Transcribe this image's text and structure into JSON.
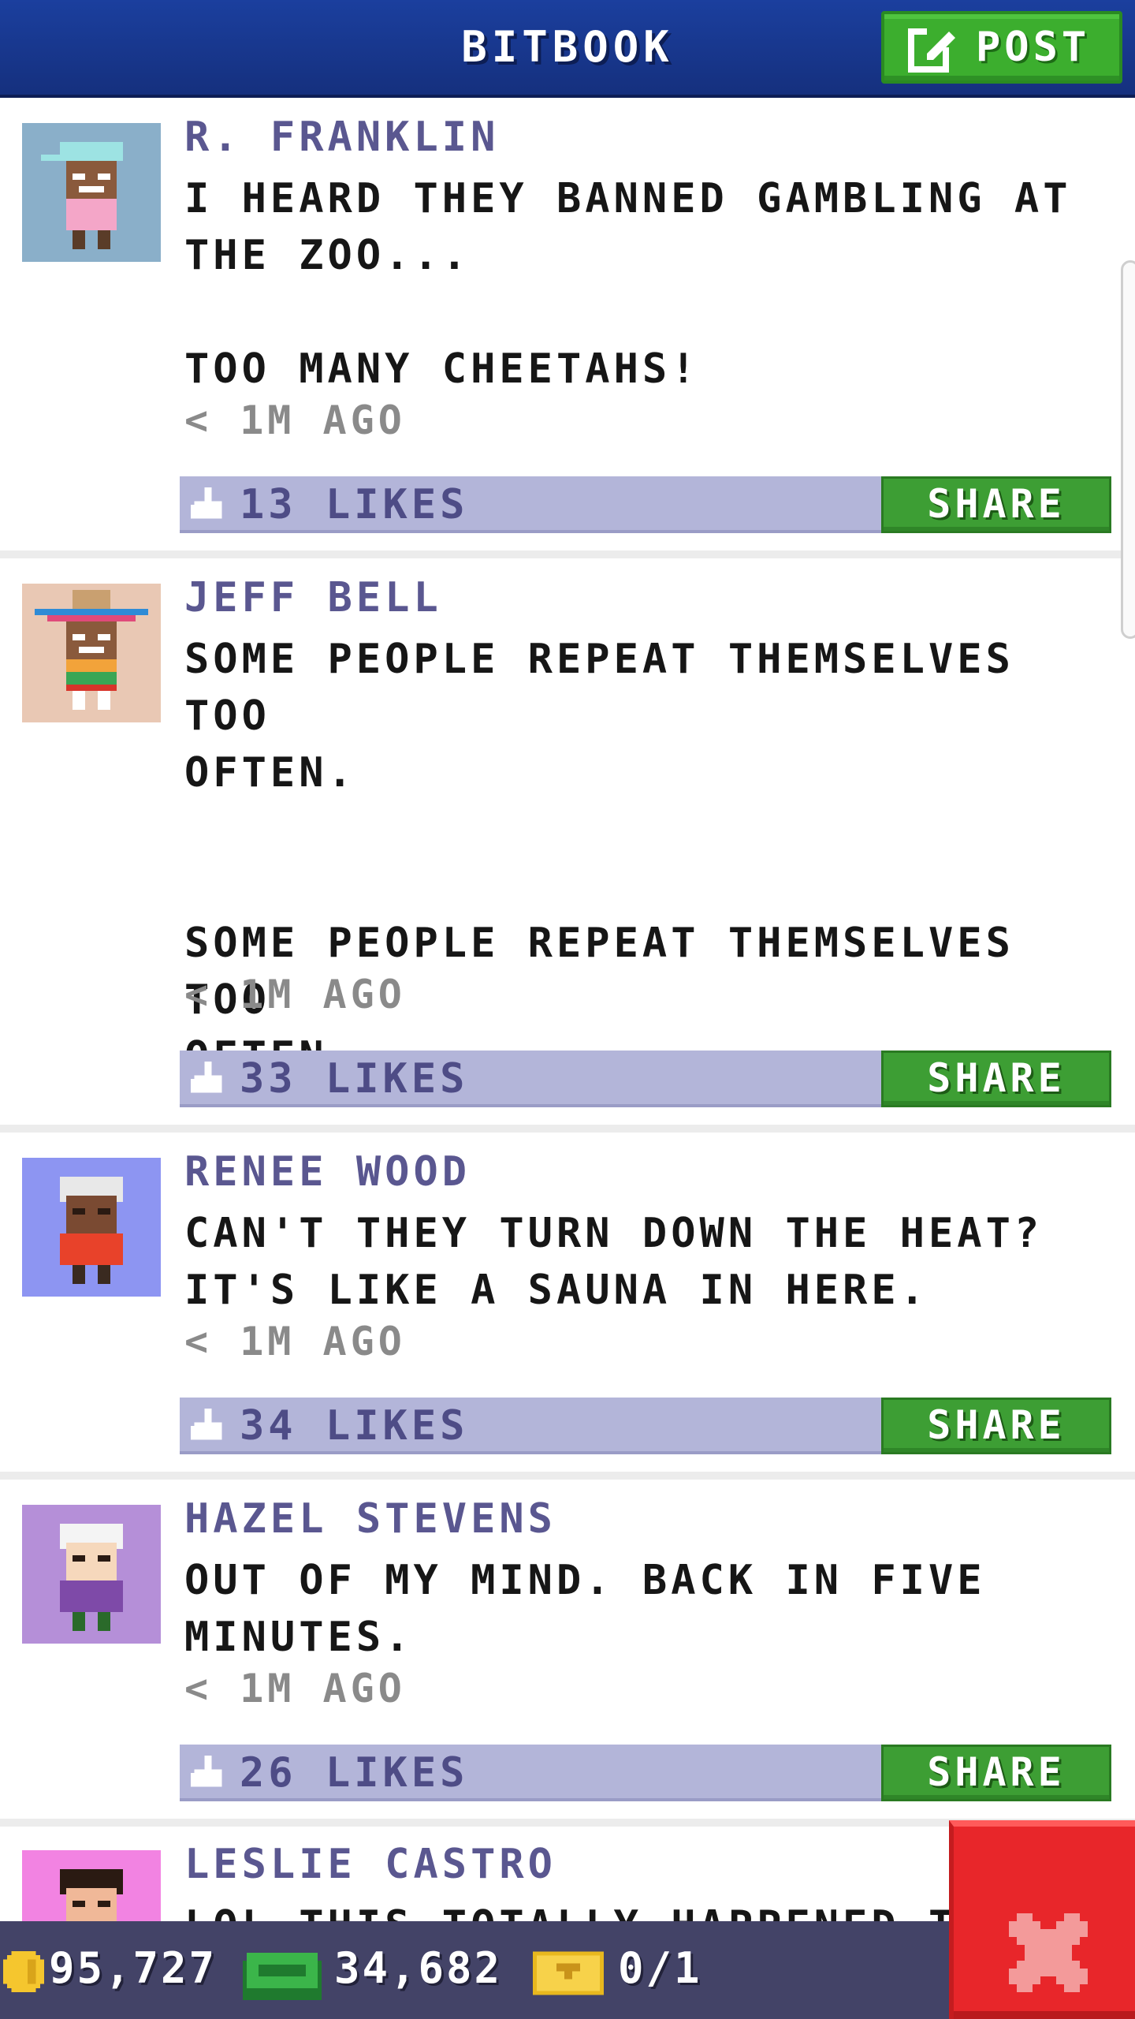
{
  "header": {
    "title": "BITBOOK",
    "post_label": "POST"
  },
  "posts": [
    {
      "author": "R. FRANKLIN",
      "text": "I HEARD THEY BANNED GAMBLING AT\nTHE ZOO...\n\nTOO MANY CHEETAHS!",
      "time": "< 1M AGO",
      "likes": "13 LIKES",
      "share_label": "SHARE",
      "avatar_bg": "#8aafc9"
    },
    {
      "author": "JEFF BELL",
      "text": "SOME PEOPLE REPEAT THEMSELVES TOO\nOFTEN.\n\n\nSOME PEOPLE REPEAT THEMSELVES TOO\nOFTEN.",
      "time": "< 1M AGO",
      "likes": "33 LIKES",
      "share_label": "SHARE",
      "avatar_bg": "#e9c8b4"
    },
    {
      "author": "RENEE WOOD",
      "text": "CAN'T THEY TURN DOWN THE HEAT?\nIT'S LIKE A SAUNA IN HERE.",
      "time": "< 1M AGO",
      "likes": "34 LIKES",
      "share_label": "SHARE",
      "avatar_bg": "#8d95f2"
    },
    {
      "author": "HAZEL STEVENS",
      "text": "OUT OF MY MIND. BACK IN FIVE\nMINUTES.",
      "time": "< 1M AGO",
      "likes": "26 LIKES",
      "share_label": "SHARE",
      "avatar_bg": "#b58fd8"
    },
    {
      "author": "LESLIE CASTRO",
      "text": "LOL THIS TOTALLY HAPPENED TO",
      "avatar_bg": "#f283e2"
    }
  ],
  "status": {
    "coins": "95,727",
    "bux": "34,682",
    "tickets": "0/1"
  },
  "colors": {
    "header": "#1b3f9e",
    "accent_green": "#3cae2e",
    "likes_bar": "#b3b5d9",
    "close_red": "#e8262a"
  }
}
